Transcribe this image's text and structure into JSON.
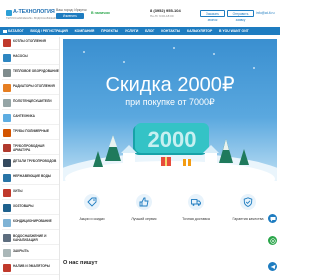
{
  "header": {
    "logo_text": "А-ТЕХНОЛОГИЯ",
    "logo_sub": "ТЕПЛОСНАБЖЕНИЕ • ВОДОСНАБЖЕНИЕ",
    "city_label": "Ваш город: Иркутск",
    "city_button": "Изменить",
    "stock_text": "В наличии",
    "phone": "8 (3952) 955-104",
    "phone_sub": "Пн-Пт 9:00-18:00",
    "button_callback": "Заказать звонок",
    "button_request": "Отправить заявку",
    "email": "info@at-lt.ru"
  },
  "nav": {
    "items": [
      "КАТАЛОГ",
      "ВХОД / РЕГИСТРАЦИЯ",
      "КОМПАНИЯ",
      "ПРОЕКТЫ",
      "УСЛУГИ",
      "БЛОГ",
      "КОНТАКТЫ",
      "КАЛЬКУЛЯТОР",
      "B YOU WANT ONT"
    ]
  },
  "sidebar": {
    "items": [
      {
        "label": "КОТЛЫ ОТОПЛЕНИЯ",
        "color": "#c0392b"
      },
      {
        "label": "НАСОСЫ",
        "color": "#2e86c1"
      },
      {
        "label": "ТЕПЛОВОЕ ОБОРУДОВАНИЕ",
        "color": "#7f8c8d"
      },
      {
        "label": "РАДИАТОРЫ ОТОПЛЕНИЯ",
        "color": "#e67e22"
      },
      {
        "label": "ПОЛОТЕНЦЕСУШИТЕЛИ",
        "color": "#95a5a6"
      },
      {
        "label": "САНТЕХНИКА",
        "color": "#5dade2"
      },
      {
        "label": "ТРУБЫ ПОЛИМЕРНЫЕ",
        "color": "#d35400"
      },
      {
        "label": "ТРУБОПРОВОДНАЯ АРМАТУРА",
        "color": "#b03a2e"
      },
      {
        "label": "ДЕТАЛИ ТРУБОПРОВОДОВ",
        "color": "#34495e"
      },
      {
        "label": "НЕРЖАВЕЮЩИЕ ВОДЫ",
        "color": "#2874a6"
      },
      {
        "label": "ХИТЫ",
        "color": "#c0392b"
      },
      {
        "label": "ХОЗТОВАРЫ",
        "color": "#1f618d"
      },
      {
        "label": "КОНДИЦИОНИРОВАНИЕ",
        "color": "#7fb3d5"
      },
      {
        "label": "ВОДОСНАБЖЕНИЕ И КАНАЛИЗАЦИЯ",
        "color": "#5d6d7e"
      },
      {
        "label": "ЗАКРЫТЬ",
        "color": "#aab7b8"
      },
      {
        "label": "НАЛИВ И ЭМАЛЯТОРЫ",
        "color": "#c0392b"
      }
    ]
  },
  "banner": {
    "title": "Скидка 2000₽",
    "subtitle": "при покупке от 7000₽",
    "number_art": "2000"
  },
  "features": [
    {
      "label": "Акции и скидки",
      "icon": "tag-icon"
    },
    {
      "label": "Лучший сервис",
      "icon": "thumb-icon"
    },
    {
      "label": "Точная доставка",
      "icon": "truck-icon"
    },
    {
      "label": "Гарантия качества",
      "icon": "shield-icon"
    }
  ],
  "reviews_title": "О нас пишут",
  "colors": {
    "brand": "#1e7cc0",
    "accent_green": "#2aa64a"
  }
}
